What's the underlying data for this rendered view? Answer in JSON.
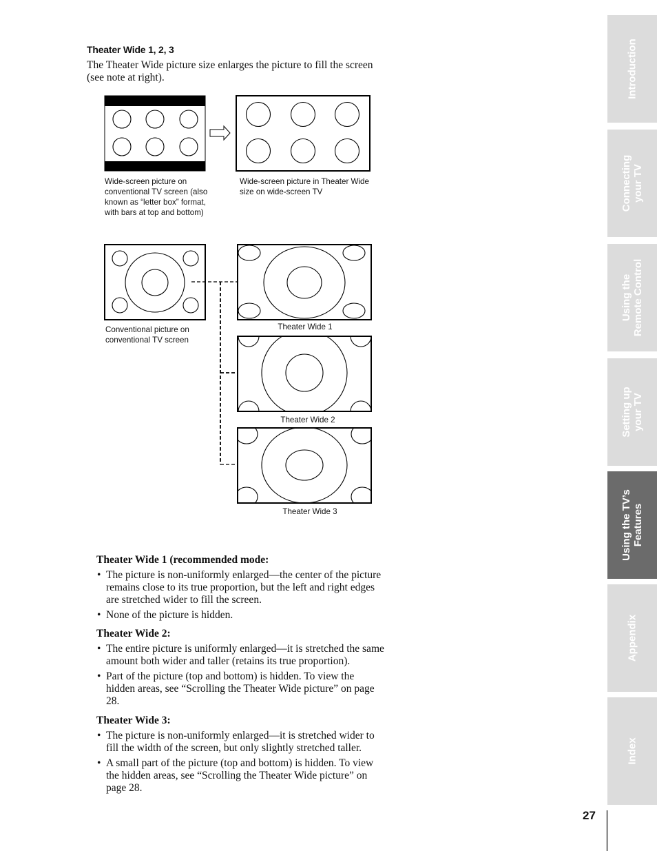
{
  "heading": "Theater Wide 1, 2, 3",
  "intro": [
    "The Theater Wide picture size enlarges the picture to fill the screen",
    "(see note at right)."
  ],
  "figure_top": {
    "left_caption": [
      "Wide-screen picture on",
      "conventional TV screen (also",
      "known as “letter box” format,",
      "with bars at top and bottom)"
    ],
    "right_caption": [
      "Wide-screen picture in Theater Wide",
      "size on wide-screen TV"
    ]
  },
  "figure_bottom": {
    "source_caption": [
      "Conventional picture on",
      "conventional TV screen"
    ],
    "tw1_label": "Theater Wide 1",
    "tw2_label": "Theater Wide 2",
    "tw3_label": "Theater Wide 3"
  },
  "sections": [
    {
      "title": "Theater Wide 1 (recommended mode:",
      "bullets": [
        [
          "The picture is non-uniformly enlarged—the center of the picture",
          "remains close to its true proportion, but the left and right edges",
          "are stretched wider to fill the screen."
        ],
        [
          "None of the picture is hidden."
        ]
      ]
    },
    {
      "title": "Theater Wide 2:",
      "bullets": [
        [
          "The entire picture is uniformly enlarged—it is stretched the same",
          "amount both wider and taller (retains its true proportion)."
        ],
        [
          "Part of the picture (top and bottom) is hidden. To view the",
          "hidden areas, see “Scrolling the Theater Wide picture” on page",
          "28."
        ]
      ]
    },
    {
      "title": "Theater Wide 3:",
      "bullets": [
        [
          "The picture is non-uniformly enlarged—it is stretched wider to",
          "fill the width of the screen, but only slightly stretched taller."
        ],
        [
          "A small part of the picture (top and bottom) is hidden. To view",
          "the hidden areas, see “Scrolling the Theater Wide picture” on",
          "page 28."
        ]
      ]
    }
  ],
  "bullet_glyph": "•",
  "side_tabs": [
    {
      "label": "Introduction",
      "active": false
    },
    {
      "label": "Connecting\nyour TV",
      "active": false
    },
    {
      "label": "Using the\nRemote Control",
      "active": false
    },
    {
      "label": "Setting up\nyour TV",
      "active": false
    },
    {
      "label": "Using the TV’s\nFeatures",
      "active": true
    },
    {
      "label": "Appendix",
      "active": false
    },
    {
      "label": "Index",
      "active": false
    }
  ],
  "colors": {
    "tab_inactive": "#dcdcdc",
    "tab_active": "#6b6b6b",
    "tab_text": "#ffffff"
  },
  "page_number": "27"
}
